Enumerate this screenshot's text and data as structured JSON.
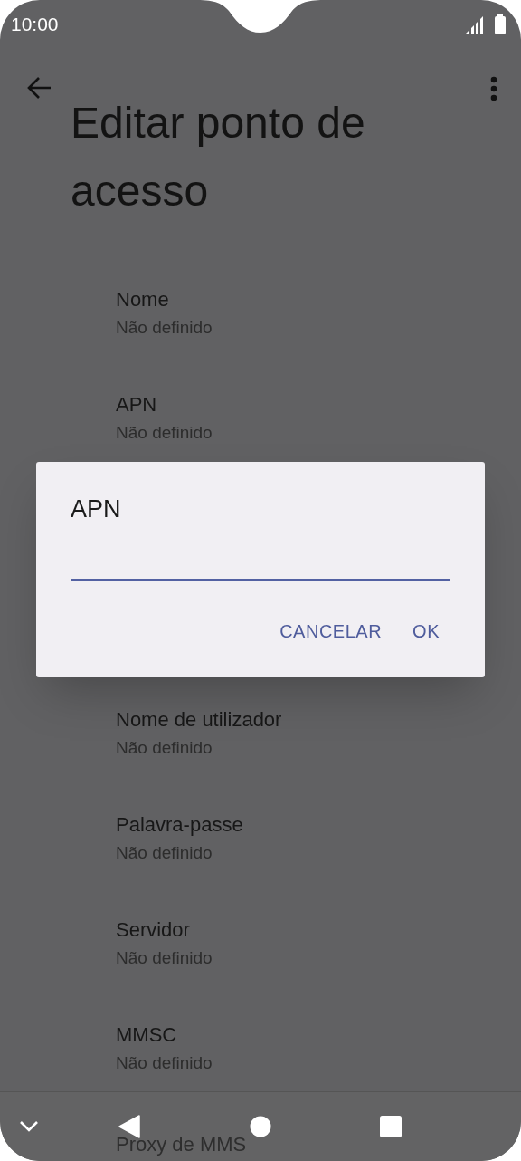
{
  "status_bar": {
    "time": "10:00"
  },
  "toolbar": {
    "title": "Editar ponto de acesso"
  },
  "settings": [
    {
      "title": "Nome",
      "summary": "Não definido"
    },
    {
      "title": "APN",
      "summary": "Não definido"
    },
    {
      "title": "Nome de utilizador",
      "summary": "Não definido"
    },
    {
      "title": "Palavra-passe",
      "summary": "Não definido"
    },
    {
      "title": "Servidor",
      "summary": "Não definido"
    },
    {
      "title": "MMSC",
      "summary": "Não definido"
    },
    {
      "title": "Proxy de MMS"
    }
  ],
  "dialog": {
    "title": "APN",
    "buttons": [
      "CANCELAR",
      "OK"
    ]
  }
}
